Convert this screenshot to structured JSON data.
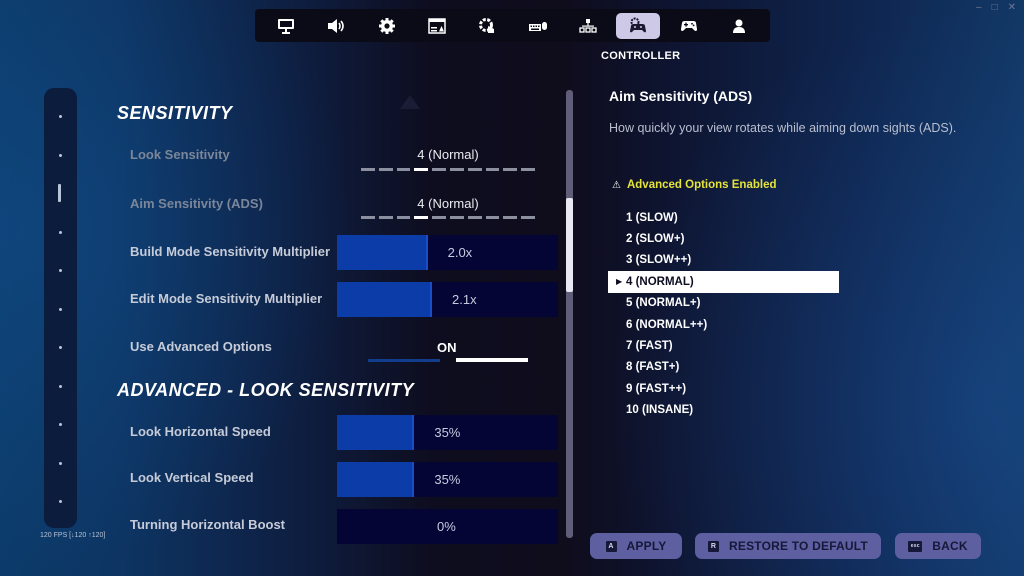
{
  "window_controls": [
    "–",
    "□",
    "✕"
  ],
  "nav": {
    "tabs": [
      {
        "icon": "monitor-icon",
        "label": "Display"
      },
      {
        "icon": "speaker-icon",
        "label": "Audio"
      },
      {
        "icon": "gear-icon",
        "label": "Game"
      },
      {
        "icon": "window-icon",
        "label": "Game UI"
      },
      {
        "icon": "touch-gear-icon",
        "label": "Touch"
      },
      {
        "icon": "keyboard-mouse-icon",
        "label": "Keyboard & Mouse"
      },
      {
        "icon": "hierarchy-icon",
        "label": "Account"
      },
      {
        "icon": "controller-gear-icon",
        "label": "Controller"
      },
      {
        "icon": "gamepad-icon",
        "label": "Controller Binds"
      },
      {
        "icon": "person-icon",
        "label": "Account & Privacy"
      }
    ],
    "active_index": 7,
    "active_caption": "CONTROLLER"
  },
  "rail": {
    "count": 11,
    "active_index": 2
  },
  "fps_readout": "120 FPS [↓120 ↑120]",
  "sections": {
    "sensitivity": {
      "title": "SENSITIVITY",
      "look_sensitivity": {
        "label": "Look Sensitivity",
        "value": "4 (Normal)",
        "level": 4,
        "steps": 10
      },
      "aim_sensitivity": {
        "label": "Aim Sensitivity (ADS)",
        "value": "4 (Normal)",
        "level": 4,
        "steps": 10
      },
      "build_multiplier": {
        "label": "Build Mode Sensitivity Multiplier",
        "value": "2.0x",
        "fill_fraction": 0.41
      },
      "edit_multiplier": {
        "label": "Edit Mode Sensitivity Multiplier",
        "value": "2.1x",
        "fill_fraction": 0.43
      },
      "advanced_options": {
        "label": "Use Advanced Options",
        "value": "ON"
      }
    },
    "advanced_look": {
      "title": "ADVANCED - LOOK SENSITIVITY",
      "horizontal_speed": {
        "label": "Look Horizontal Speed",
        "value": "35%",
        "fill_fraction": 0.35
      },
      "vertical_speed": {
        "label": "Look Vertical Speed",
        "value": "35%",
        "fill_fraction": 0.35
      },
      "turning_boost": {
        "label": "Turning Horizontal Boost",
        "value": "0%",
        "fill_fraction": 0
      }
    }
  },
  "scrollbar": {
    "position_fraction": 0.24,
    "visible_fraction": 0.21
  },
  "detail": {
    "title": "Aim Sensitivity (ADS)",
    "description": "How quickly your view rotates while aiming down sights (ADS).",
    "warning_icon": "⚠",
    "advanced_note": "Advanced Options Enabled",
    "options": [
      "1 (SLOW)",
      "2 (SLOW+)",
      "3 (SLOW++)",
      "4 (NORMAL)",
      "5 (NORMAL+)",
      "6 (NORMAL++)",
      "7 (FAST)",
      "8 (FAST+)",
      "9 (FAST++)",
      "10 (INSANE)"
    ],
    "selected_index": 3
  },
  "footer": {
    "apply": {
      "key": "A",
      "label": "APPLY"
    },
    "restore": {
      "key": "R",
      "label": "RESTORE TO DEFAULT"
    },
    "back": {
      "key": "esc",
      "label": "BACK"
    }
  }
}
